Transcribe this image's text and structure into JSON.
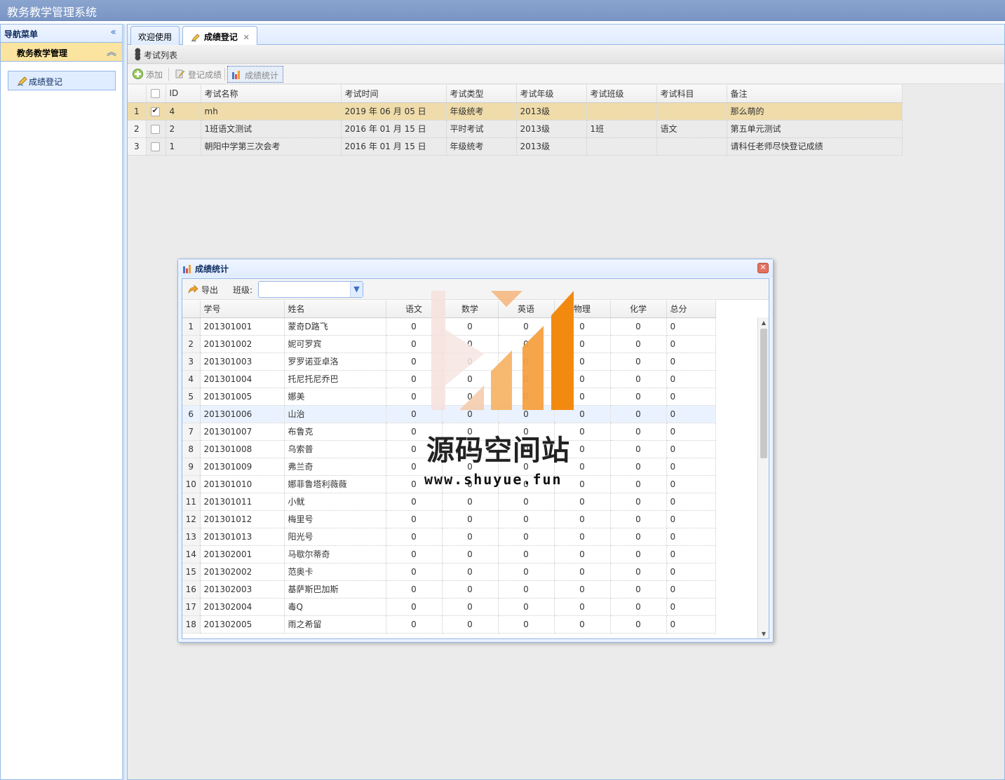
{
  "app": {
    "title": "教务教学管理系统"
  },
  "nav": {
    "title": "导航菜单",
    "section_title": "教务教学管理",
    "items": [
      {
        "label": "成绩登记"
      }
    ]
  },
  "tabs": [
    {
      "label": "欢迎使用"
    },
    {
      "label": "成绩登记",
      "closable": true
    }
  ],
  "panel": {
    "title": "考试列表"
  },
  "toolbar": {
    "add_label": "添加",
    "register_label": "登记成绩",
    "stats_label": "成绩统计"
  },
  "exam_grid": {
    "columns": [
      "ID",
      "考试名称",
      "考试时间",
      "考试类型",
      "考试年级",
      "考试班级",
      "考试科目",
      "备注"
    ],
    "rows": [
      {
        "rn": "1",
        "checked": true,
        "id": "4",
        "name": "mh",
        "time": "2019 年 06 月 05 日",
        "type": "年级统考",
        "grade": "2013级",
        "class": "",
        "subject": "",
        "note": "那么萌的"
      },
      {
        "rn": "2",
        "checked": false,
        "id": "2",
        "name": "1班语文测试",
        "time": "2016 年 01 月 15 日",
        "type": "平时考试",
        "grade": "2013级",
        "class": "1班",
        "subject": "语文",
        "note": "第五单元测试"
      },
      {
        "rn": "3",
        "checked": false,
        "id": "1",
        "name": "朝阳中学第三次会考",
        "time": "2016 年 01 月 15 日",
        "type": "年级统考",
        "grade": "2013级",
        "class": "",
        "subject": "",
        "note": "请科任老师尽快登记成绩"
      }
    ]
  },
  "dialog": {
    "title": "成绩统计",
    "export_label": "导出",
    "class_label": "班级:",
    "class_value": "",
    "columns": [
      "学号",
      "姓名",
      "语文",
      "数学",
      "英语",
      "物理",
      "化学",
      "总分"
    ],
    "rows": [
      {
        "rn": "1",
        "sid": "201301001",
        "name": "蒙奇D路飞",
        "s1": "0",
        "s2": "0",
        "s3": "0",
        "s4": "0",
        "s5": "0",
        "total": "0"
      },
      {
        "rn": "2",
        "sid": "201301002",
        "name": "妮可罗宾",
        "s1": "0",
        "s2": "0",
        "s3": "0",
        "s4": "0",
        "s5": "0",
        "total": "0"
      },
      {
        "rn": "3",
        "sid": "201301003",
        "name": "罗罗诺亚卓洛",
        "s1": "0",
        "s2": "0",
        "s3": "0",
        "s4": "0",
        "s5": "0",
        "total": "0"
      },
      {
        "rn": "4",
        "sid": "201301004",
        "name": "托尼托尼乔巴",
        "s1": "0",
        "s2": "0",
        "s3": "0",
        "s4": "0",
        "s5": "0",
        "total": "0"
      },
      {
        "rn": "5",
        "sid": "201301005",
        "name": "娜美",
        "s1": "0",
        "s2": "0",
        "s3": "0",
        "s4": "0",
        "s5": "0",
        "total": "0"
      },
      {
        "rn": "6",
        "sid": "201301006",
        "name": "山治",
        "s1": "0",
        "s2": "0",
        "s3": "0",
        "s4": "0",
        "s5": "0",
        "total": "0"
      },
      {
        "rn": "7",
        "sid": "201301007",
        "name": "布鲁克",
        "s1": "0",
        "s2": "0",
        "s3": "0",
        "s4": "0",
        "s5": "0",
        "total": "0"
      },
      {
        "rn": "8",
        "sid": "201301008",
        "name": "乌索普",
        "s1": "0",
        "s2": "0",
        "s3": "0",
        "s4": "0",
        "s5": "0",
        "total": "0"
      },
      {
        "rn": "9",
        "sid": "201301009",
        "name": "弗兰奇",
        "s1": "0",
        "s2": "0",
        "s3": "0",
        "s4": "0",
        "s5": "0",
        "total": "0"
      },
      {
        "rn": "10",
        "sid": "201301010",
        "name": "娜菲鲁塔利薇薇",
        "s1": "0",
        "s2": "0",
        "s3": "0",
        "s4": "0",
        "s5": "0",
        "total": "0"
      },
      {
        "rn": "11",
        "sid": "201301011",
        "name": "小鱿",
        "s1": "0",
        "s2": "0",
        "s3": "0",
        "s4": "0",
        "s5": "0",
        "total": "0"
      },
      {
        "rn": "12",
        "sid": "201301012",
        "name": "梅里号",
        "s1": "0",
        "s2": "0",
        "s3": "0",
        "s4": "0",
        "s5": "0",
        "total": "0"
      },
      {
        "rn": "13",
        "sid": "201301013",
        "name": "阳光号",
        "s1": "0",
        "s2": "0",
        "s3": "0",
        "s4": "0",
        "s5": "0",
        "total": "0"
      },
      {
        "rn": "14",
        "sid": "201302001",
        "name": "马歇尔蒂奇",
        "s1": "0",
        "s2": "0",
        "s3": "0",
        "s4": "0",
        "s5": "0",
        "total": "0"
      },
      {
        "rn": "15",
        "sid": "201302002",
        "name": "范奥卡",
        "s1": "0",
        "s2": "0",
        "s3": "0",
        "s4": "0",
        "s5": "0",
        "total": "0"
      },
      {
        "rn": "16",
        "sid": "201302003",
        "name": "基萨斯巴加斯",
        "s1": "0",
        "s2": "0",
        "s3": "0",
        "s4": "0",
        "s5": "0",
        "total": "0"
      },
      {
        "rn": "17",
        "sid": "201302004",
        "name": "毒Q",
        "s1": "0",
        "s2": "0",
        "s3": "0",
        "s4": "0",
        "s5": "0",
        "total": "0"
      },
      {
        "rn": "18",
        "sid": "201302005",
        "name": "雨之希留",
        "s1": "0",
        "s2": "0",
        "s3": "0",
        "s4": "0",
        "s5": "0",
        "total": "0"
      }
    ]
  },
  "watermark": {
    "text": "源码空间站",
    "url": "www.shuyue.fun"
  },
  "colors": {
    "header": "#7a95c4",
    "selected_row": "#efdcaa",
    "nav_section": "#fbe49f",
    "accent": "#95b8e7"
  }
}
